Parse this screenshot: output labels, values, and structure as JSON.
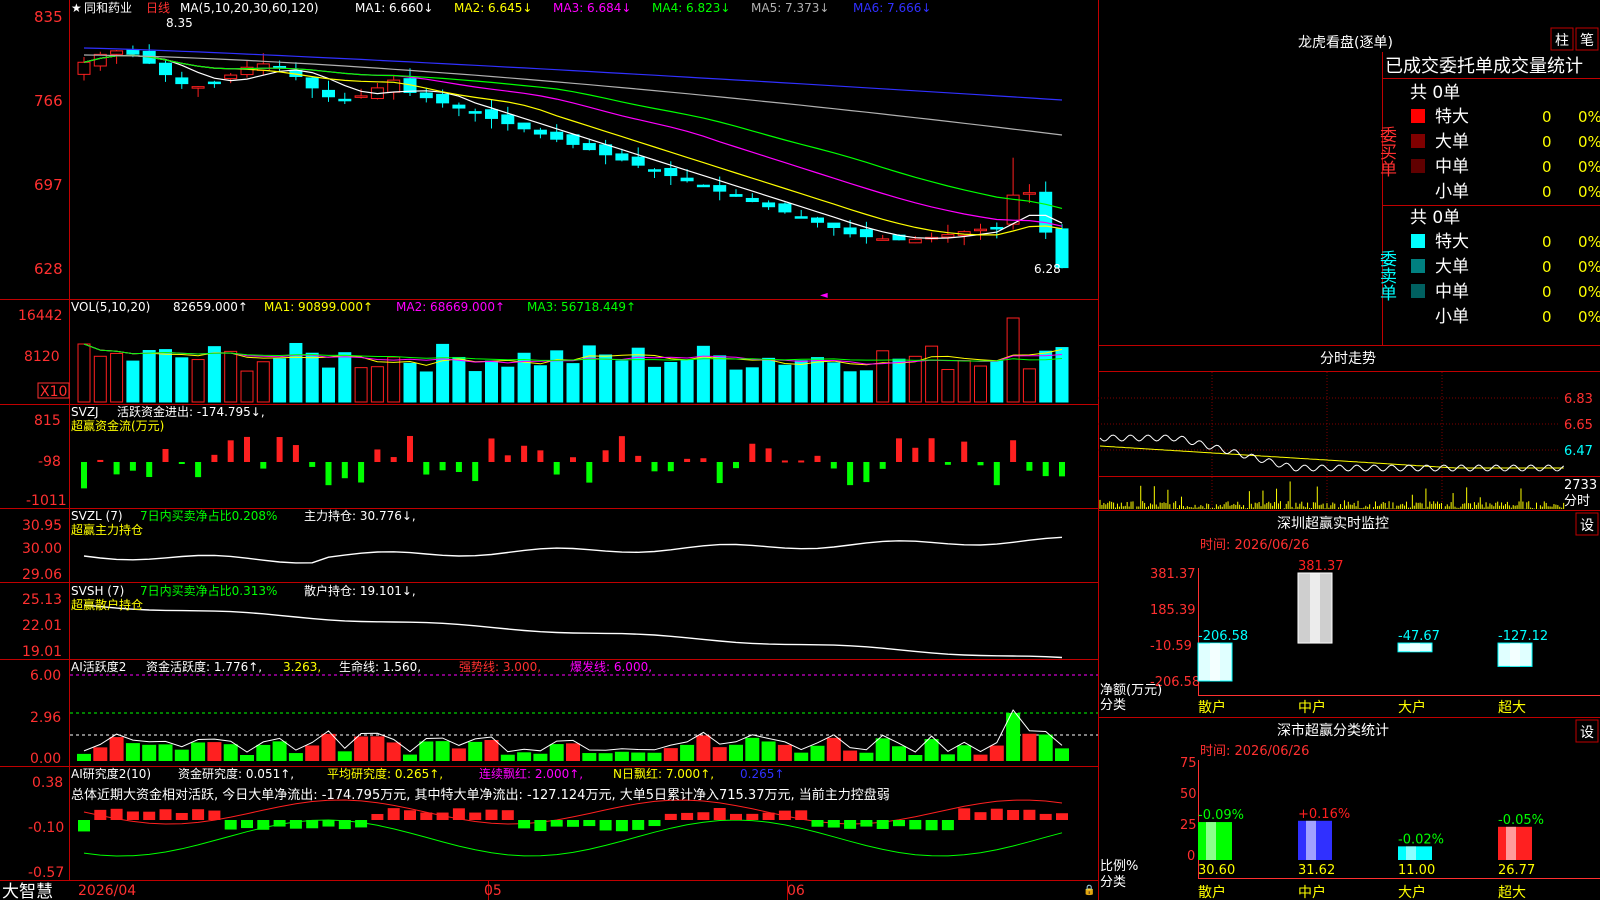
{
  "colors": {
    "up": "#ff2020",
    "down": "#00ffff",
    "frame": "#c00000",
    "white": "#ffffff",
    "yellow": "#ffff00",
    "magenta": "#ff00ff",
    "green": "#00ff00",
    "blue": "#3030ff",
    "gray": "#b0b0b0",
    "axis": "#ff3030"
  },
  "main": {
    "stock_name": "同和药业",
    "period": "日线",
    "ma_label": "MA(5,10,20,30,60,120)",
    "ma1": "MA1: 6.660↓",
    "ma2": "MA2: 6.645↓",
    "ma3": "MA3: 6.684↓",
    "ma4": "MA4: 6.823↓",
    "ma5": "MA5: 7.373↓",
    "ma6": "MA6: 7.666↓",
    "high_label": "8.35",
    "low_label": "6.28",
    "yticks": [
      "835",
      "766",
      "697",
      "628"
    ]
  },
  "vol": {
    "title": "VOL(5,10,20)",
    "value": "82659.000↑",
    "ma1": "MA1: 90899.000↑",
    "ma2": "MA2: 68669.000↑",
    "ma3": "MA3: 56718.449↑",
    "yticks": [
      "16442",
      "8120"
    ],
    "unit": "X10"
  },
  "svzj": {
    "title": "SVZJ",
    "line1": "活跃资金进出: -174.795↓,",
    "line2": "超赢资金流(万元)",
    "yticks": [
      "815",
      "-98",
      "-1011"
    ]
  },
  "svzl": {
    "title": "SVZL (7)",
    "part1": "7日内买卖净占比0.208%",
    "part2": "主力持仓: 30.776↓,",
    "line2": "超赢主力持仓",
    "yticks": [
      "30.95",
      "30.00",
      "29.06"
    ]
  },
  "svsh": {
    "title": "SVSH (7)",
    "part1": "7日内买卖净占比0.313%",
    "part2": "散户持仓: 19.101↓,",
    "line2": "超赢散户持仓",
    "yticks": [
      "25.13",
      "22.01",
      "19.01"
    ]
  },
  "ai1": {
    "title": "AI活跃度2",
    "part1": "资金活跃度: 1.776↑,",
    "part2": "3.263,",
    "part3": "生命线: 1.560,",
    "part4": "强势线: 3.000,",
    "part5": "爆发线: 6.000,",
    "yticks": [
      "6.00",
      "2.96",
      "0.00"
    ]
  },
  "ai2": {
    "title": "AI研究度2(10)",
    "part1": "资金研究度: 0.051↑,",
    "part2": "平均研究度: 0.265↑,",
    "part3": "连续飘红: 2.000↑,",
    "part4": "N日飘红: 7.000↑,",
    "part5": "0.265↑",
    "summary": "总体近期大资金相对活跃, 今日大单净流出: -174.795万元, 其中特大单净流出: -127.124万元, 大单5日累计净入715.37万元, 当前主力控盘弱",
    "yticks": [
      "0.38",
      "-0.10",
      "-0.57"
    ]
  },
  "bottom": {
    "brand": "大智慧",
    "date_label": "2026/04",
    "month2": "05",
    "month3": "06"
  },
  "dragon": {
    "title": "龙虎看盘(逐单)",
    "btn_bar": "柱",
    "btn_pen": "笔",
    "subtitle": "已成交委托单成交量统计",
    "buy_side": "委买单",
    "sell_side": "委卖单",
    "buy_total": "共 0单",
    "sell_total": "共 0单",
    "buy_rows": [
      {
        "label": "特大",
        "v": "0",
        "p": "0%"
      },
      {
        "label": "大单",
        "v": "0",
        "p": "0%"
      },
      {
        "label": "中单",
        "v": "0",
        "p": "0%"
      },
      {
        "label": "小单",
        "v": "0",
        "p": "0%"
      }
    ],
    "sell_rows": [
      {
        "label": "特大",
        "v": "0",
        "p": "0%"
      },
      {
        "label": "大单",
        "v": "0",
        "p": "0%"
      },
      {
        "label": "中单",
        "v": "0",
        "p": "0%"
      },
      {
        "label": "小单",
        "v": "0",
        "p": "0%"
      }
    ]
  },
  "intraday": {
    "title": "分时走势",
    "yticks": [
      "6.83",
      "6.65",
      "6.47"
    ],
    "vol_value": "2733",
    "vol_label": "分时"
  },
  "monitor": {
    "title": "深圳超赢实时监控",
    "btn": "设",
    "time": "时间: 2026/06/26",
    "yticks": [
      "381.37",
      "185.39",
      "-10.59",
      "-206.58"
    ],
    "ylabel": "净额(万元)",
    "xlabel": "分类",
    "bars": [
      {
        "cat": "散户",
        "label": "-206.58",
        "value": -206.58
      },
      {
        "cat": "中户",
        "label": "381.37",
        "value": 381.37
      },
      {
        "cat": "大户",
        "label": "-47.67",
        "value": -47.67
      },
      {
        "cat": "超大",
        "label": "-127.12",
        "value": -127.12
      }
    ]
  },
  "category": {
    "title": "深市超赢分类统计",
    "btn": "设",
    "time": "时间: 2026/06/26",
    "yticks": [
      "75",
      "50",
      "25",
      "0"
    ],
    "ylabel": "比例%",
    "xlabel": "分类",
    "bars": [
      {
        "cat": "散户",
        "value": 30.6,
        "val_label": "30.60",
        "chg": "-0.09%"
      },
      {
        "cat": "中户",
        "value": 31.62,
        "val_label": "31.62",
        "chg": "+0.16%"
      },
      {
        "cat": "大户",
        "value": 11.0,
        "val_label": "11.00",
        "chg": "-0.02%"
      },
      {
        "cat": "超大",
        "value": 26.77,
        "val_label": "26.77",
        "chg": "-0.05%"
      }
    ]
  }
}
